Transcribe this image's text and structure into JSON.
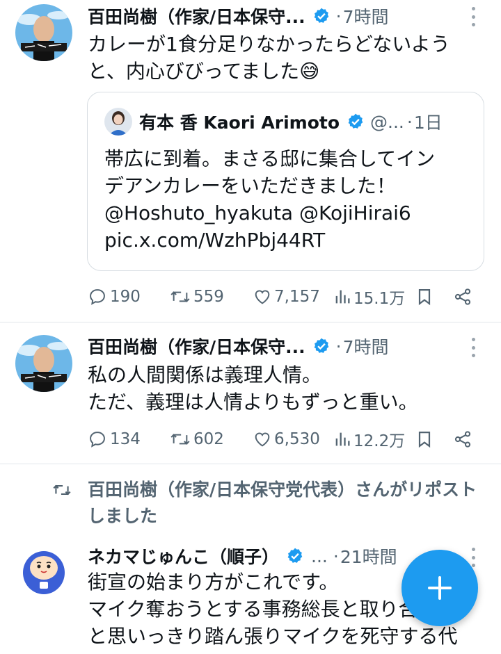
{
  "tweets": [
    {
      "author": "百田尚樹（作家/日本保守...",
      "time": "7時間",
      "lines": [
        "カレーが1食分足りなかったらどないよう",
        "と、内心びびってました😅"
      ],
      "quote": {
        "author": "有本 香 Kaori Arimoto",
        "handle": "@...",
        "time": "1日",
        "lines": [
          "帯広に到着。まさる邸に集合してイン",
          "デアンカレーをいただきました！",
          "@Hoshuto_hyakuta @KojiHirai6",
          "pic.x.com/WzhPbj44RT"
        ]
      },
      "replies": "190",
      "reposts": "559",
      "likes": "7,157",
      "views": "15.1万"
    },
    {
      "author": "百田尚樹（作家/日本保守...",
      "time": "7時間",
      "lines": [
        "私の人間関係は義理人情。",
        "ただ、義理は人情よりもずっと重い。"
      ],
      "replies": "134",
      "reposts": "602",
      "likes": "6,530",
      "views": "12.2万"
    },
    {
      "repost_notice": [
        "百田尚樹（作家/日本保守党代表）さんがリポスト",
        "しました"
      ],
      "author": "ネカマじゅんこ（順子）",
      "handle": "...",
      "time": "21時間",
      "lines": [
        "街宣の始まり方がこれです。",
        "マイク奪おうとする事務総長と取り合い",
        "と思いっきり踏ん張りマイクを死守する代"
      ]
    }
  ],
  "icons": {
    "verified": "verified-badge-icon",
    "more": "more-vertical-icon",
    "reply": "reply-icon",
    "repost": "repost-icon",
    "like": "heart-icon",
    "views": "views-icon",
    "bookmark": "bookmark-icon",
    "share": "share-icon",
    "compose": "plus-icon"
  },
  "colors": {
    "accent": "#1d9bf0",
    "text": "#0f1419",
    "secondary": "#536471"
  }
}
